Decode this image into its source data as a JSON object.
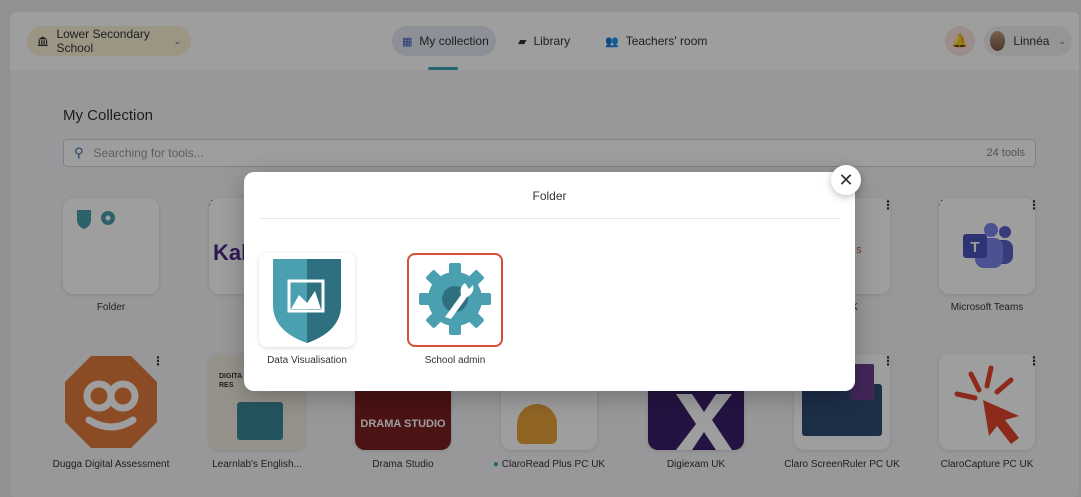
{
  "topbar": {
    "school": "Lower Secondary School",
    "nav": [
      {
        "label": "My collection",
        "active": true,
        "icon": "grid-icon"
      },
      {
        "label": "Library",
        "icon": "book-icon"
      },
      {
        "label": "Teachers' room",
        "icon": "users-icon"
      }
    ],
    "user_name": "Linnéa"
  },
  "collection": {
    "title": "My Collection",
    "search_placeholder": "Searching for tools...",
    "tool_count": "24 tools",
    "row1": [
      {
        "label": "Folder"
      },
      {
        "label": "K"
      },
      {
        "label": "tics UK"
      },
      {
        "label": "Microsoft Teams"
      }
    ],
    "row2": [
      {
        "label": "Dugga Digital Assessment"
      },
      {
        "label": "Learnlab's English..."
      },
      {
        "label": "Drama Studio",
        "logo_text": "DRAMA STUDIO"
      },
      {
        "label": "ClaroRead Plus PC UK",
        "has_dot": true
      },
      {
        "label": "Digiexam UK"
      },
      {
        "label": "Claro ScreenRuler PC UK"
      },
      {
        "label": "ClaroCapture PC UK"
      }
    ],
    "learnlab_tile_text": "DIGITA RES",
    "kahoot_fragment": "Kal",
    "analytics_fragment": "YTICS"
  },
  "modal": {
    "title": "Folder",
    "items": [
      {
        "label": "Data Visualisation",
        "selected": false
      },
      {
        "label": "School admin",
        "selected": true
      }
    ]
  },
  "colors": {
    "accent_teal": "#4a9fb0",
    "selected_border": "#d94f35",
    "dugga_orange": "#e07a3a"
  }
}
